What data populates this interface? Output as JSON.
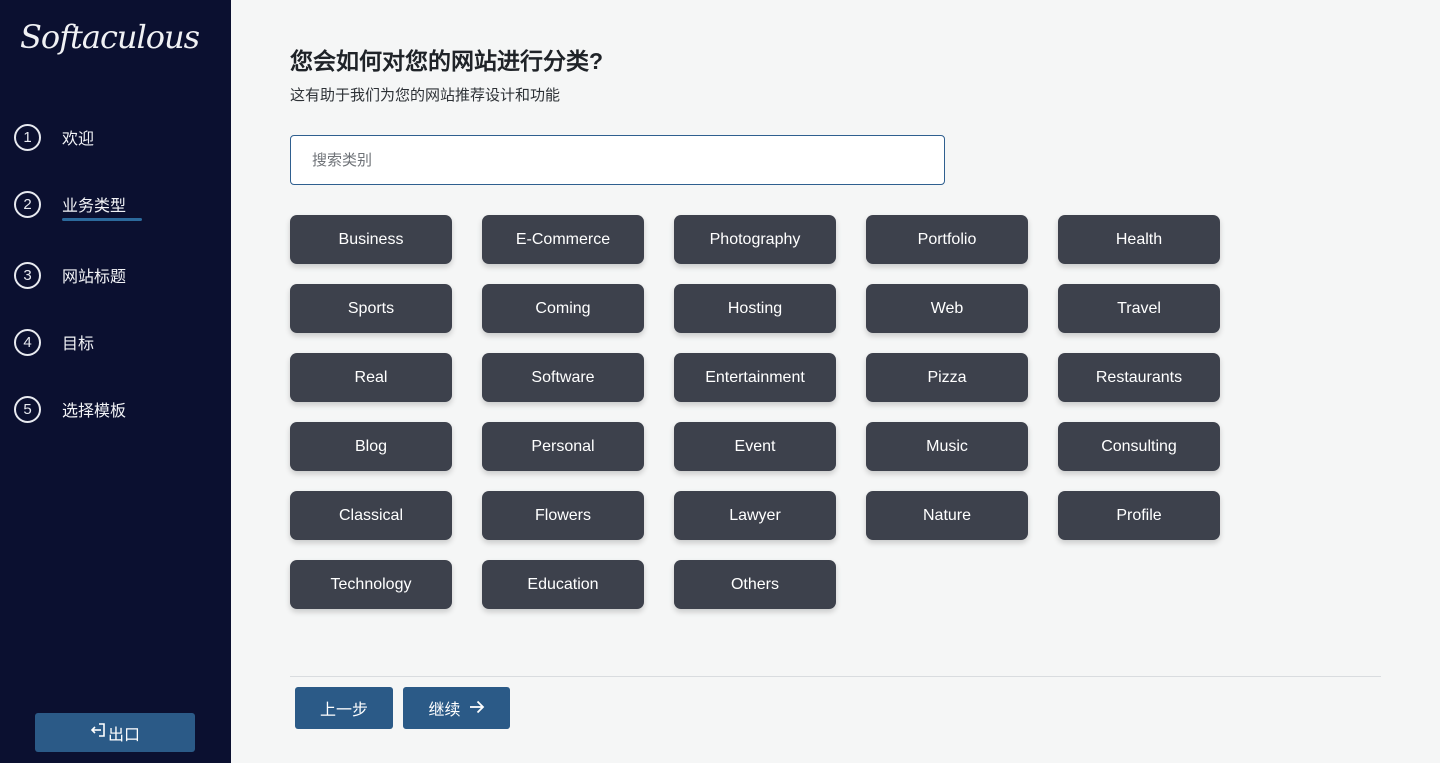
{
  "sidebar": {
    "logo": "Softaculous",
    "steps": [
      {
        "num": "1",
        "label": "欢迎"
      },
      {
        "num": "2",
        "label": "业务类型"
      },
      {
        "num": "3",
        "label": "网站标题"
      },
      {
        "num": "4",
        "label": "目标"
      },
      {
        "num": "5",
        "label": "选择模板"
      }
    ],
    "active_step": 2,
    "exit_label": "出口",
    "exit_icon": "sign-out-icon"
  },
  "main": {
    "title": "您会如何对您的网站进行分类?",
    "subtitle": "这有助于我们为您的网站推荐设计和功能",
    "search": {
      "placeholder": "搜索类别",
      "value": ""
    },
    "categories": [
      "Business",
      "E-Commerce",
      "Photography",
      "Portfolio",
      "Health",
      "Sports",
      "Coming",
      "Hosting",
      "Web",
      "Travel",
      "Real",
      "Software",
      "Entertainment",
      "Pizza",
      "Restaurants",
      "Blog",
      "Personal",
      "Event",
      "Music",
      "Consulting",
      "Classical",
      "Flowers",
      "Lawyer",
      "Nature",
      "Profile",
      "Technology",
      "Education",
      "Others"
    ],
    "prev_label": "上一步",
    "next_label": "继续",
    "next_icon": "arrow-right-icon"
  },
  "colors": {
    "sidebar_bg": "#0b1030",
    "accent": "#2b5a87",
    "category_bg": "#3d414c",
    "page_bg": "#f5f6f6"
  }
}
